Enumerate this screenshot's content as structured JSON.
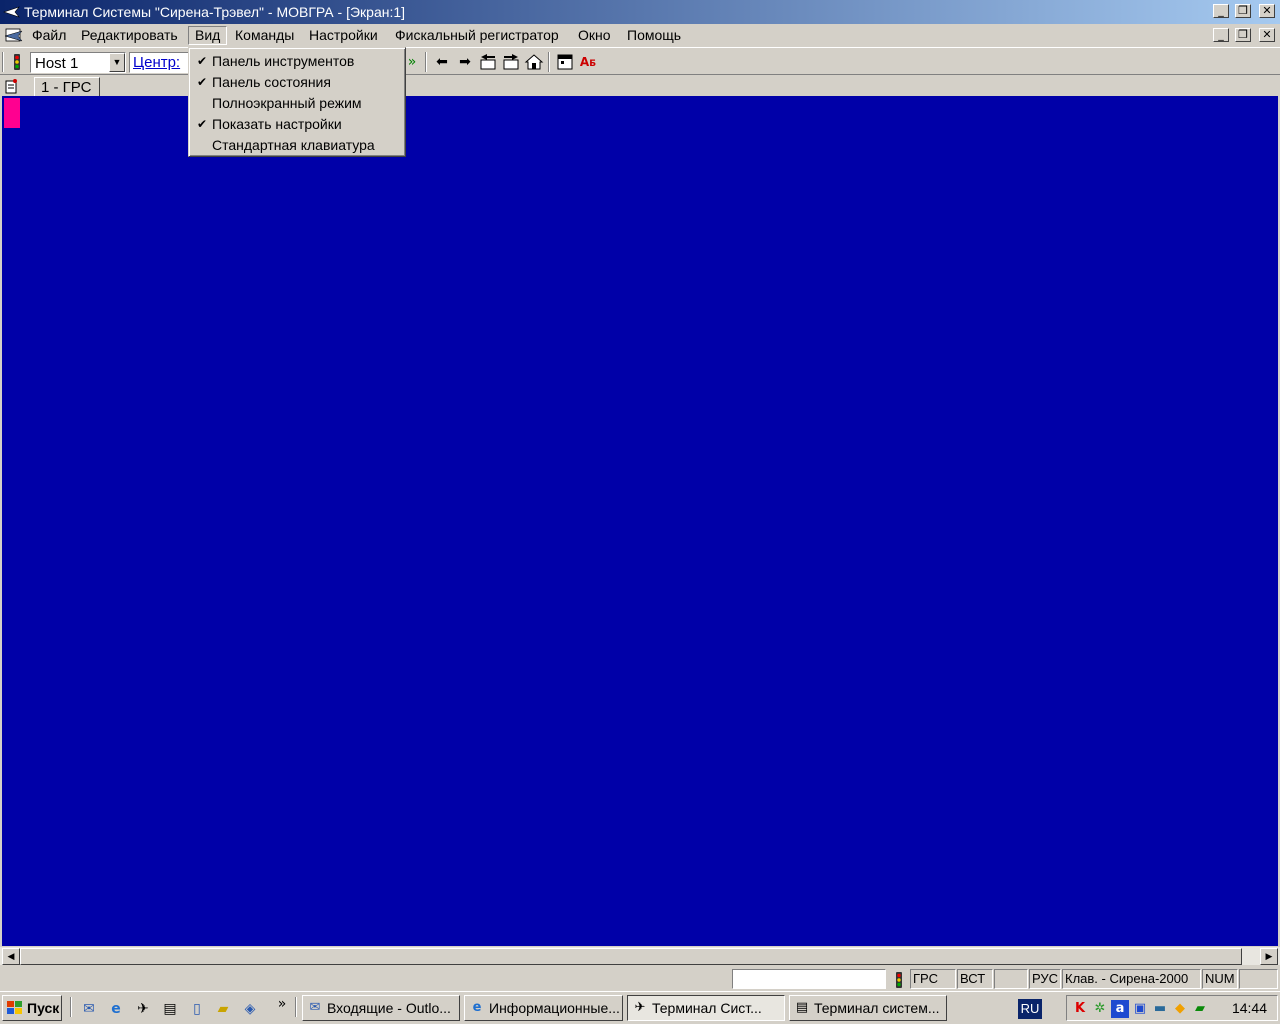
{
  "window": {
    "title": "Терминал Системы \"Сирена-Трэвел\" - МОВГРА - [Экран:1]",
    "icon": "airplane-icon",
    "controls": [
      "_",
      "❐",
      "✕"
    ]
  },
  "menubar": {
    "items": [
      "Файл",
      "Редактировать",
      "Вид",
      "Команды",
      "Настройки",
      "Фискальный регистратор",
      "Окно",
      "Помощь"
    ],
    "active": "Вид",
    "mdi_controls": [
      "_",
      "❐",
      "✕"
    ]
  },
  "toolbar": {
    "host": "Host 1",
    "center": "Центр:",
    "icons": [
      "traffic-light-icon",
      "fast-forward-icon",
      "arrow-left-icon",
      "arrow-right-icon",
      "list-left-icon",
      "list-right-icon",
      "home-icon",
      "calendar-icon",
      "spellcheck-icon"
    ]
  },
  "tabs": {
    "active": "1 - ГРС"
  },
  "view_menu": {
    "items": [
      {
        "label": "Панель инструментов",
        "checked": true
      },
      {
        "label": "Панель состояния",
        "checked": true
      },
      {
        "label": "Полноэкранный режим",
        "checked": false
      },
      {
        "label": "Показать настройки",
        "checked": true
      },
      {
        "label": "Стандартная клавиатура",
        "checked": false
      }
    ]
  },
  "terminal": {
    "background": "#0000a8",
    "cursor_color": "#ff0090"
  },
  "statusbar": {
    "system": "ГРС",
    "mode": "ВСТ",
    "lang": "РУС",
    "keyboard": "Клав. - Сирена-2000",
    "num": "NUM"
  },
  "taskbar": {
    "start": "Пуск",
    "chevron": "»",
    "tasks": [
      {
        "label": "Входящие - Outlo...",
        "icon": "outlook-icon",
        "pressed": false
      },
      {
        "label": "Информационные...",
        "icon": "ie-icon",
        "pressed": false
      },
      {
        "label": "Терминал Сист...",
        "icon": "airplane-icon",
        "pressed": true
      },
      {
        "label": "Терминал систем...",
        "icon": "document-icon",
        "pressed": false
      }
    ],
    "language": "RU",
    "clock": "14:44"
  }
}
